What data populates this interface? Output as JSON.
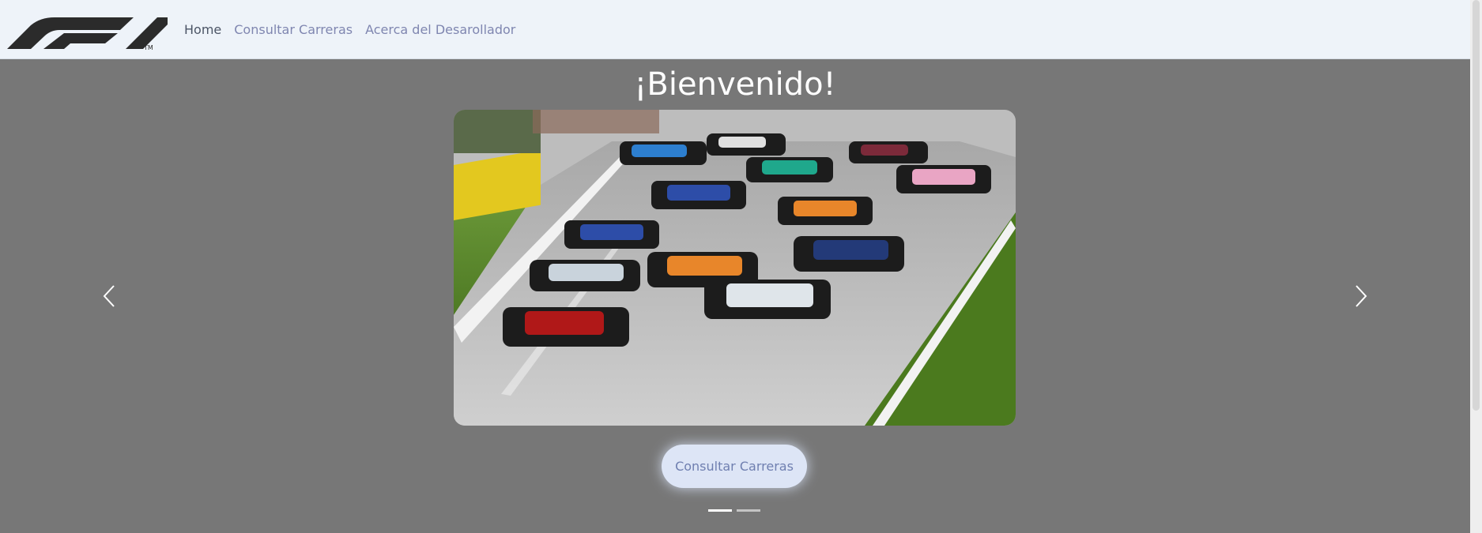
{
  "navbar": {
    "logo_icon": "f1-logo-icon",
    "links": [
      {
        "label": "Home",
        "active": true
      },
      {
        "label": "Consultar Carreras",
        "active": false
      },
      {
        "label": "Acerca del Desarollador",
        "active": false
      }
    ]
  },
  "hero": {
    "title": "¡Bienvenido!",
    "image": "f1-race-start-photo",
    "prev_icon": "chevron-left-icon",
    "next_icon": "chevron-right-icon",
    "cta_label": "Consultar Carreras",
    "slide_count": 2,
    "active_slide": 1
  },
  "colors": {
    "background": "#777777",
    "navbar_bg": "#eef3f9",
    "link": "#7f86b0",
    "link_active": "#4c5566",
    "cta_bg": "#dde5f6"
  }
}
